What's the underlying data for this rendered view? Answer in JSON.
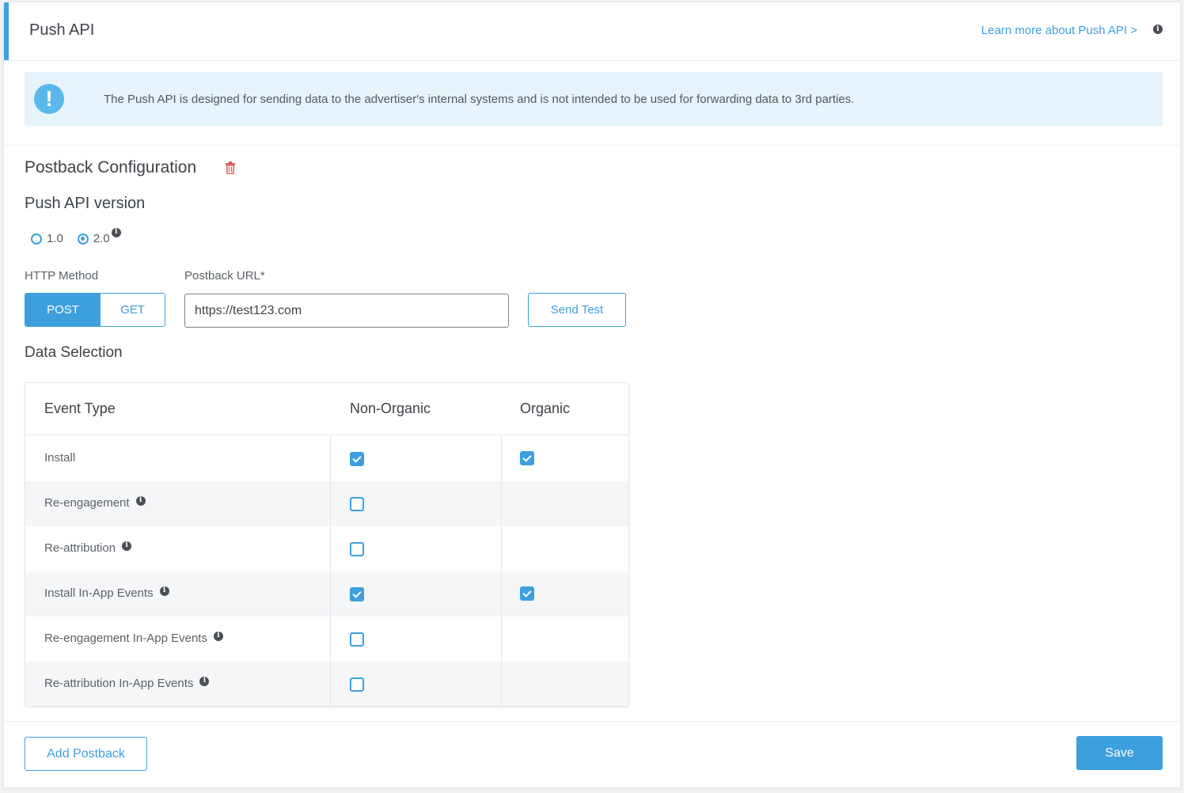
{
  "header": {
    "title": "Push API",
    "learn_link": "Learn more about Push API >"
  },
  "alert": {
    "icon": "exclamation-icon",
    "text": "The Push API is designed for sending data to the advertiser's internal systems and is not intended to be used for forwarding data to 3rd parties."
  },
  "postback": {
    "title": "Postback Configuration",
    "delete_icon": "trash-icon",
    "version_title": "Push API version",
    "versions": [
      {
        "label": "1.0",
        "selected": false
      },
      {
        "label": "2.0",
        "selected": true
      }
    ],
    "http_method_label": "HTTP Method",
    "methods": [
      {
        "label": "POST",
        "selected": true
      },
      {
        "label": "GET",
        "selected": false
      }
    ],
    "url_label": "Postback URL*",
    "url_value": "https://test123.com",
    "send_test_label": "Send Test"
  },
  "data_selection": {
    "title": "Data Selection",
    "columns": [
      "Event Type",
      "Non-Organic",
      "Organic"
    ],
    "rows": [
      {
        "event": "Install",
        "info": false,
        "non_organic": true,
        "organic": true
      },
      {
        "event": "Re-engagement",
        "info": true,
        "non_organic": false,
        "organic": null
      },
      {
        "event": "Re-attribution",
        "info": true,
        "non_organic": false,
        "organic": null
      },
      {
        "event": "Install In-App Events",
        "info": true,
        "non_organic": true,
        "organic": true
      },
      {
        "event": "Re-engagement In-App Events",
        "info": true,
        "non_organic": false,
        "organic": null
      },
      {
        "event": "Re-attribution In-App Events",
        "info": true,
        "non_organic": false,
        "organic": null
      }
    ]
  },
  "footer": {
    "add_postback_label": "Add Postback",
    "save_label": "Save"
  },
  "colors": {
    "accent": "#3e9fde",
    "alert_bg": "#e6f3fb",
    "delete": "#e0574f"
  }
}
